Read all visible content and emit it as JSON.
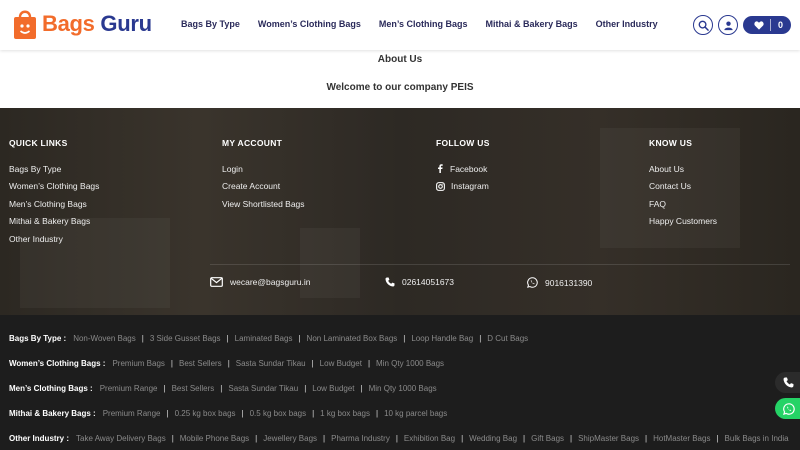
{
  "brand": {
    "name_part1": "Bags",
    "name_part2": "Guru",
    "accent_color": "#f26c2b",
    "primary_color": "#2a3990"
  },
  "nav": {
    "items": [
      "Bags By Type",
      "Women’s Clothing Bags",
      "Men’s Clothing Bags",
      "Mithai & Bakery Bags",
      "Other Industry"
    ]
  },
  "header_actions": {
    "search_icon": "search-icon",
    "account_icon": "user-icon",
    "favorites_icon": "heart-icon",
    "favorites_count": "0"
  },
  "about": {
    "title": "About Us",
    "text": "Welcome to our company PEIS"
  },
  "footer": {
    "quick_links": {
      "heading": "QUICK LINKS",
      "items": [
        "Bags By Type",
        "Women’s Clothing Bags",
        "Men’s Clothing Bags",
        "Mithai & Bakery Bags",
        "Other Industry"
      ]
    },
    "my_account": {
      "heading": "MY ACCOUNT",
      "items": [
        "Login",
        "Create Account",
        "View Shortlisted Bags"
      ]
    },
    "follow_us": {
      "heading": "FOLLOW US",
      "items": [
        "Facebook",
        "Instagram"
      ]
    },
    "know_us": {
      "heading": "KNOW US",
      "items": [
        "About Us",
        "Contact Us",
        "FAQ",
        "Happy Customers"
      ]
    },
    "contact": {
      "email": "wecare@bagsguru.in",
      "phone": "02614051673",
      "whatsapp": "9016131390"
    }
  },
  "categories": [
    {
      "title": "Bags By Type :",
      "items": [
        "Non-Woven Bags",
        "3 Side Gusset Bags",
        "Laminated Bags",
        "Non Laminated Box Bags",
        "Loop Handle Bag",
        "D Cut Bags"
      ]
    },
    {
      "title": "Women’s Clothing Bags :",
      "items": [
        "Premium Bags",
        "Best Sellers",
        "Sasta Sundar Tikau",
        "Low Budget",
        "Min Qty 1000 Bags"
      ]
    },
    {
      "title": "Men’s Clothing Bags :",
      "items": [
        "Premium Range",
        "Best Sellers",
        "Sasta Sundar Tikau",
        "Low Budget",
        "Min Qty 1000 Bags"
      ]
    },
    {
      "title": "Mithai & Bakery Bags :",
      "items": [
        "Premium Range",
        "0.25 kg box bags",
        "0.5 kg box bags",
        "1 kg box bags",
        "10 kg parcel bags"
      ]
    },
    {
      "title": "Other Industry :",
      "items": [
        "Take Away Delivery Bags",
        "Mobile Phone Bags",
        "Jewellery Bags",
        "Pharma Industry",
        "Exhibition Bag",
        "Wedding Bag",
        "Gift Bags",
        "ShipMaster Bags",
        "HotMaster Bags",
        "Bulk Bags in India"
      ]
    }
  ],
  "floating": {
    "call_color": "#2b2b2b",
    "whatsapp_color": "#25d366"
  }
}
